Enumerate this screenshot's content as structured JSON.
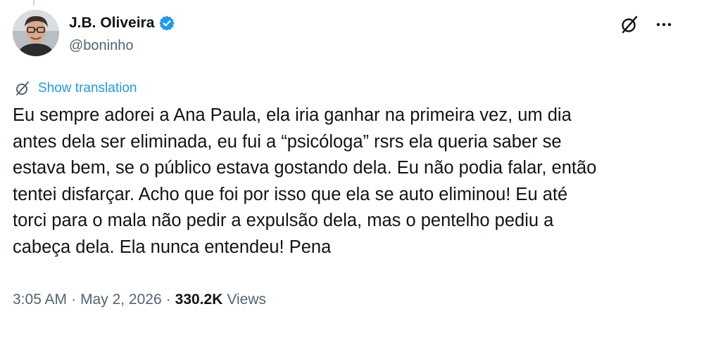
{
  "author": {
    "display_name": "J.B. Oliveira",
    "handle": "@boninho",
    "verified": true,
    "verified_color": "#1d9bf0"
  },
  "header": {
    "grok_icon": "grok-icon",
    "more_icon": "more-horizontal-icon"
  },
  "translation": {
    "label": "Show translation",
    "icon": "translate-icon",
    "color": "#1d9bf0"
  },
  "tweet": {
    "lines": [
      "Eu sempre adorei a Ana Paula, ela iria ganhar na primeira vez, um dia",
      "antes dela ser eliminada, eu fui a “psicóloga” rsrs ela queria saber se",
      "estava bem, se o público estava gostando dela. Eu não podia falar, então",
      "tentei disfarçar. Acho que foi por isso que ela se auto eliminou! Eu até",
      "torci para o mala não pedir a expulsão dela, mas o pentelho pediu a",
      "cabeça dela. Ela nunca entendeu! Pena"
    ]
  },
  "meta": {
    "time": "3:05 AM",
    "separator": "·",
    "date": "May 2, 2026",
    "views_count": "330.2K",
    "views_label": "Views"
  }
}
